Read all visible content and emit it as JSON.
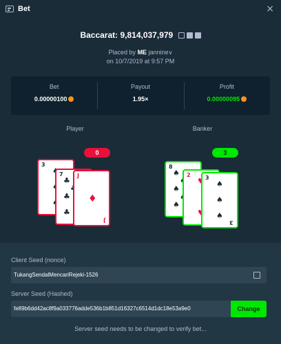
{
  "window": {
    "title": "Bet",
    "close_glyph": "×"
  },
  "game": {
    "title": "Baccarat: 9,814,037,979",
    "placed_by_prefix": "Placed by",
    "user_tag": "ME",
    "user_name": "jannine",
    "user_chevron": "∨",
    "date": "on 10/7/2019 at 9:57 PM"
  },
  "stats": {
    "bet_label": "Bet",
    "bet_value": "0.00000100",
    "payout_label": "Payout",
    "payout_value": "1.95×",
    "profit_label": "Profit",
    "profit_value": "0.00000095",
    "profit_color": "#00e701",
    "currency_icon": "bitcoin-icon"
  },
  "player": {
    "label": "Player",
    "score": "0",
    "cards": [
      {
        "rank": "3",
        "suit": "♠",
        "color": "black"
      },
      {
        "rank": "7",
        "suit": "♣",
        "color": "black"
      },
      {
        "rank": "J",
        "suit": "♦",
        "color": "red"
      }
    ]
  },
  "banker": {
    "label": "Banker",
    "score": "3",
    "cards": [
      {
        "rank": "8",
        "suit": "♠",
        "color": "black"
      },
      {
        "rank": "2",
        "suit": "♥",
        "color": "red"
      },
      {
        "rank": "3",
        "suit": "♠",
        "color": "black"
      }
    ]
  },
  "seeds": {
    "client_label": "Client Seed (nonce)",
    "client_value": "TukangSendalMencariRejeki-1526",
    "server_label": "Server Seed (Hashed)",
    "server_value": "fe89b6dd42ac8f9a033776adde536b1b851d16327c6514d1dc18e53a9e0",
    "change_label": "Change",
    "notice": "Server seed needs to be changed to verify bet..."
  }
}
